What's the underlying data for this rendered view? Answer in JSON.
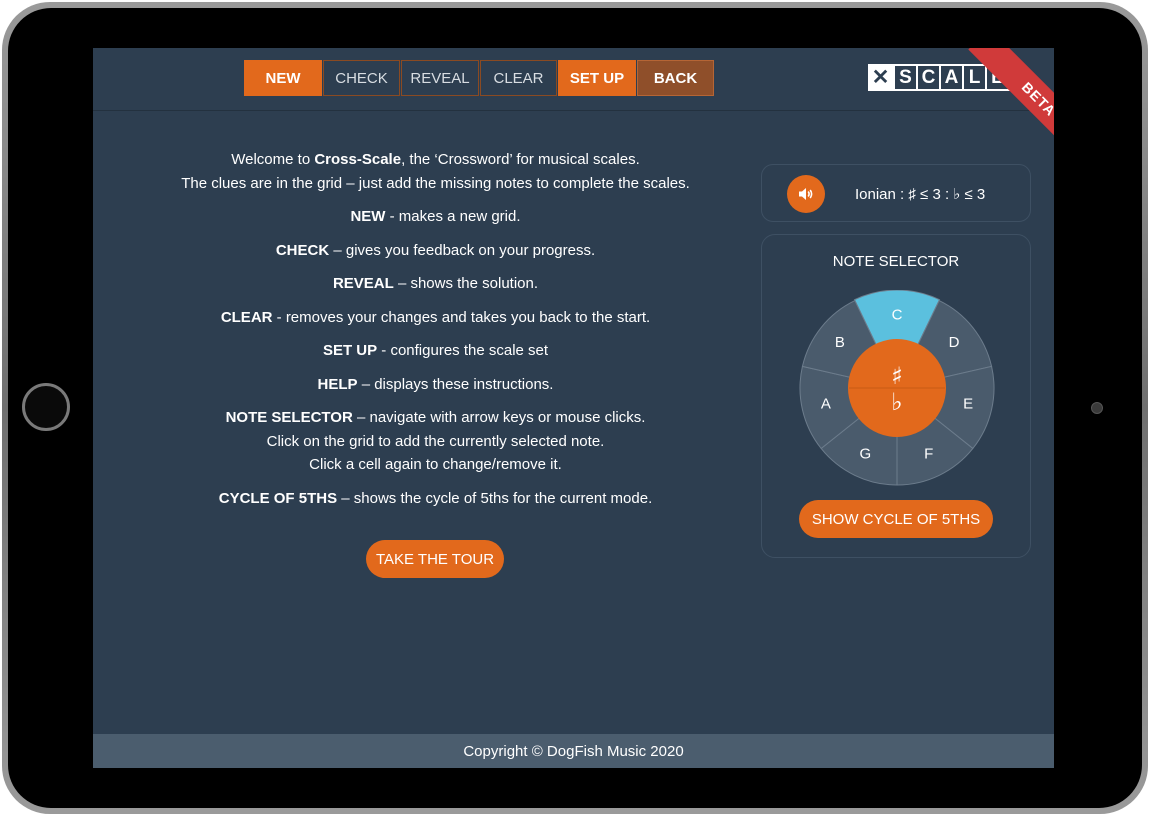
{
  "toolbar": {
    "buttons": [
      {
        "label": "NEW"
      },
      {
        "label": "CHECK"
      },
      {
        "label": "REVEAL"
      },
      {
        "label": "CLEAR"
      },
      {
        "label": "SET UP"
      },
      {
        "label": "BACK"
      }
    ]
  },
  "logo": {
    "x_mark": "✕",
    "letters": [
      "S",
      "C",
      "A",
      "L",
      "E"
    ]
  },
  "instructions": {
    "welcome_prefix": "Welcome to ",
    "app_name": "Cross-Scale",
    "welcome_suffix": ", the ‘Crossword’ for musical scales.",
    "clues_line": "The clues are in the grid – just add the missing notes to complete the scales.",
    "items": [
      {
        "term": "NEW",
        "desc": " - makes a new grid."
      },
      {
        "term": "CHECK",
        "desc": " – gives you feedback on your progress."
      },
      {
        "term": "REVEAL",
        "desc": " – shows the solution."
      },
      {
        "term": "CLEAR",
        "desc": " - removes your changes and takes you back to the start."
      },
      {
        "term": "SET UP",
        "desc": " - configures the scale set"
      },
      {
        "term": "HELP",
        "desc": " – displays these instructions."
      },
      {
        "term": "NOTE SELECTOR",
        "desc": " – navigate with arrow keys or mouse clicks."
      }
    ],
    "note_line2": "Click on the grid to add the currently selected note.",
    "note_line3": "Click a cell again to change/remove it.",
    "cycle_term": "CYCLE OF 5THS",
    "cycle_desc": " – shows the cycle of 5ths for the current mode."
  },
  "tour_button": "TAKE THE TOUR",
  "mode": {
    "speaker_icon": "speaker-icon",
    "text": "Ionian : ♯ ≤ 3 : ♭ ≤ 3"
  },
  "note_selector": {
    "title": "NOTE SELECTOR",
    "notes": [
      "C",
      "D",
      "E",
      "F",
      "G",
      "A",
      "B"
    ],
    "selected": "C",
    "sharp": "♯",
    "flat": "♭"
  },
  "cycle_button": "SHOW CYCLE OF 5THS",
  "beta": "BETA",
  "footer": "Copyright © DogFish Music 2020",
  "colors": {
    "accent": "#e2691c",
    "background": "#2d3e50",
    "selected": "#5bc0de",
    "segment": "#4a5b6c",
    "beta": "#d03a3a"
  }
}
